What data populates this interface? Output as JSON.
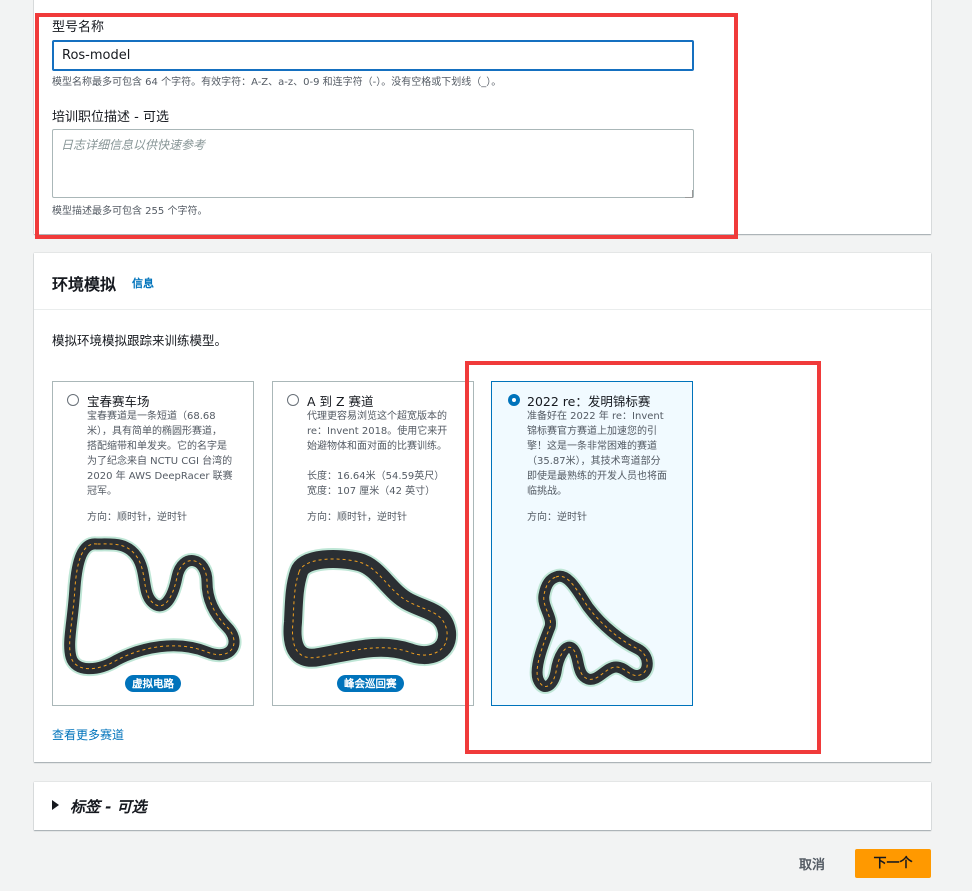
{
  "model": {
    "name_label": "型号名称",
    "name_value": "Ros-model",
    "name_hint": "模型名称最多可包含 64 个字符。有效字符：A-Z、a-z、0-9 和连字符（-）。没有空格或下划线（_）。",
    "desc_label": "培训职位描述 - 可选",
    "desc_placeholder": "日志详细信息以供快速参考",
    "desc_hint": "模型描述最多可包含 255 个字符。"
  },
  "environment": {
    "title": "环境模拟",
    "info_link": "信息",
    "intro": "模拟环境模拟跟踪来训练模型。",
    "more_tracks_link": "查看更多赛道",
    "tracks": [
      {
        "name": "宝春赛车场",
        "desc": [
          "宝春赛道是一条短道（68.68",
          "米），具有简单的椭圆形赛道，",
          "搭配缩带和单发夹。它的名字是",
          "为了纪念来自 NCTU CGI 台湾的",
          "2020 年 AWS DeepRacer 联赛",
          "冠军。"
        ],
        "direction": "方向：顺时针，逆时针",
        "badge": "虚拟电路",
        "selected": false
      },
      {
        "name": "A 到 Z 赛道",
        "desc": [
          "代理更容易浏览这个超宽版本的",
          "re：Invent 2018。使用它来开",
          "始避物体和面对面的比赛训练。",
          "",
          "长度：16.64米（54.59英尺）",
          "宽度：107 厘米（42 英寸）"
        ],
        "direction": "方向：顺时针，逆时针",
        "badge": "峰会巡回赛",
        "selected": false
      },
      {
        "name": "2022 re：发明锦标赛",
        "desc": [
          "准备好在 2022 年 re：Invent",
          "锦标赛官方赛道上加速您的引",
          "擎！这是一条非常困难的赛道",
          "（35.87米），其技术弯道部分",
          "即使是最熟练的开发人员也将面",
          "临挑战。"
        ],
        "direction": "方向：逆时针",
        "badge": "",
        "selected": true
      }
    ]
  },
  "tags": {
    "title": "标签 - 可选"
  },
  "footer": {
    "cancel": "取消",
    "next": "下一个"
  },
  "colors": {
    "accent": "#0073bb",
    "primary_button": "#ff9900",
    "highlight": "#f03a3a"
  }
}
